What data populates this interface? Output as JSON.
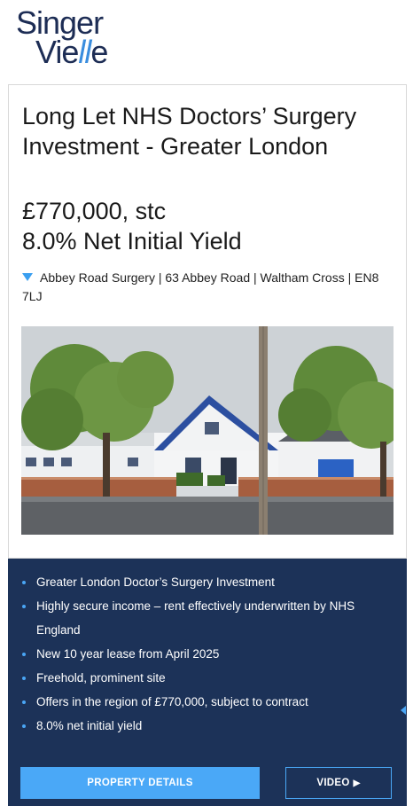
{
  "logo": {
    "line1": "Singer",
    "line2_prefix": "Vie",
    "line2_accent": "ll",
    "line2_suffix": "e"
  },
  "listing": {
    "title": "Long Let NHS Doctors’ Surgery Investment - Greater London",
    "price": "£770,000, stc",
    "yield": "8.0% Net Initial Yield",
    "address": "Abbey Road Surgery | 63 Abbey Road | Waltham Cross | EN8 7LJ"
  },
  "highlights": [
    "Greater London Doctor’s Surgery Investment",
    "Highly secure income – rent effectively underwritten by NHS England",
    "New 10 year lease from April 2025",
    "Freehold, prominent site",
    "Offers in the region of £770,000, subject to contract",
    "8.0% net initial yield"
  ],
  "buttons": {
    "details": "PROPERTY DETAILS",
    "video": "VIDEO",
    "video_icon": "▶"
  },
  "colors": {
    "brand_navy": "#1c3258",
    "accent_blue": "#4aa8f7",
    "logo_navy": "#1d2d55"
  },
  "icons": {
    "address": "location-pin-icon",
    "video": "play-icon"
  }
}
